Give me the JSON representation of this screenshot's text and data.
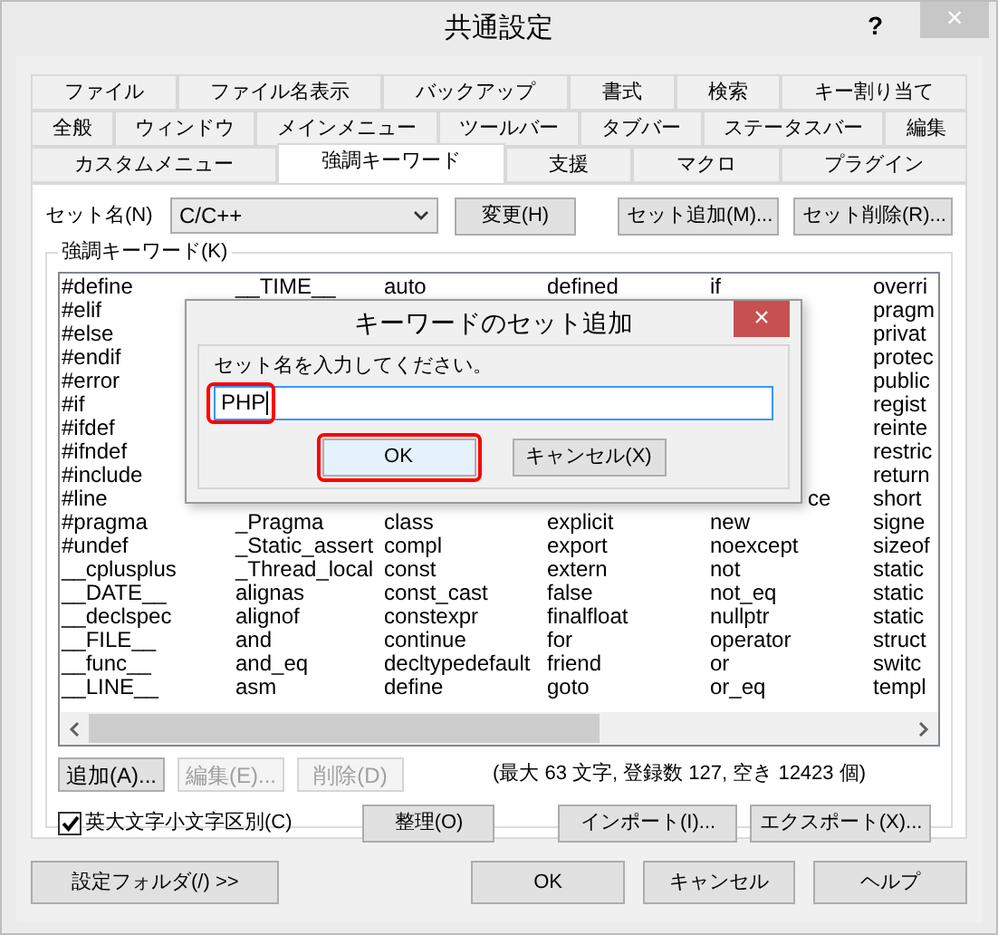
{
  "window": {
    "title": "共通設定",
    "help": "?",
    "close": "×"
  },
  "tab_rows": [
    [
      {
        "label": "ファイル",
        "selected": false
      },
      {
        "label": "ファイル名表示",
        "selected": false
      },
      {
        "label": "バックアップ",
        "selected": false
      },
      {
        "label": "書式",
        "selected": false
      },
      {
        "label": "検索",
        "selected": false
      },
      {
        "label": "キー割り当て",
        "selected": false
      }
    ],
    [
      {
        "label": "全般",
        "selected": false
      },
      {
        "label": "ウィンドウ",
        "selected": false
      },
      {
        "label": "メインメニュー",
        "selected": false
      },
      {
        "label": "ツールバー",
        "selected": false
      },
      {
        "label": "タブバー",
        "selected": false
      },
      {
        "label": "ステータスバー",
        "selected": false
      },
      {
        "label": "編集",
        "selected": false
      }
    ],
    [
      {
        "label": "カスタムメニュー",
        "selected": false
      },
      {
        "label": "強調キーワード",
        "selected": true
      },
      {
        "label": "支援",
        "selected": false
      },
      {
        "label": "マクロ",
        "selected": false
      },
      {
        "label": "プラグイン",
        "selected": false
      }
    ]
  ],
  "set_row": {
    "label": "セット名(N)",
    "value": "C/C++",
    "buttons": [
      "変更(H)",
      "セット追加(M)...",
      "セット削除(R)..."
    ]
  },
  "keywords": {
    "label": "強調キーワード(K)",
    "rows": [
      [
        "#define",
        "__TIME__",
        "auto",
        "defined",
        "if",
        "overri"
      ],
      [
        "#elif",
        null,
        null,
        null,
        null,
        "pragm"
      ],
      [
        "#else",
        null,
        null,
        null,
        null,
        "privat"
      ],
      [
        "#endif",
        null,
        null,
        null,
        null,
        "protec"
      ],
      [
        "#error",
        null,
        null,
        null,
        null,
        "public"
      ],
      [
        "#if",
        null,
        null,
        null,
        null,
        "regist"
      ],
      [
        "#ifdef",
        null,
        null,
        null,
        null,
        "reinte"
      ],
      [
        "#ifndef",
        null,
        null,
        null,
        null,
        "restric"
      ],
      [
        "#include",
        null,
        null,
        null,
        null,
        "return"
      ],
      [
        "#line",
        null,
        null,
        null,
        {
          "text": "ce",
          "kind": "tail"
        },
        "short"
      ],
      [
        "#pragma",
        "_Pragma",
        "class",
        "explicit",
        "new",
        "signe"
      ],
      [
        "#undef",
        "_Static_assert",
        "compl",
        "export",
        "noexcept",
        "sizeof"
      ],
      [
        "__cplusplus",
        "_Thread_local",
        "const",
        "extern",
        "not",
        "static"
      ],
      [
        "__DATE__",
        "alignas",
        "const_cast",
        "false",
        "not_eq",
        "static"
      ],
      [
        "__declspec",
        "alignof",
        "constexpr",
        "finalfloat",
        "nullptr",
        "static"
      ],
      [
        "__FILE__",
        "and",
        "continue",
        "for",
        "operator",
        "struct"
      ],
      [
        "__func__",
        "and_eq",
        "decltypedefault",
        "friend",
        "or",
        "switc"
      ],
      [
        "__LINE__",
        "asm",
        "define",
        "goto",
        "or_eq",
        "templ"
      ]
    ]
  },
  "list_buttons": [
    {
      "label": "追加(A)...",
      "disabled": false
    },
    {
      "label": "編集(E)...",
      "disabled": true
    },
    {
      "label": "削除(D)",
      "disabled": true
    }
  ],
  "stats": "(最大 63 文字, 登録数 127, 空き 12423 個)",
  "case_checkbox": {
    "label": "英大文字小文字区別(C)",
    "checked": true
  },
  "tool_buttons": [
    "整理(O)",
    "インポート(I)...",
    "エクスポート(X)..."
  ],
  "footer_buttons": [
    "設定フォルダ(/) >>",
    "OK",
    "キャンセル",
    "ヘルプ"
  ],
  "dialog": {
    "title": "キーワードのセット追加",
    "close": "×",
    "prompt": "セット名を入力してください。",
    "value": "PHP",
    "buttons": [
      "OK",
      "キャンセル(X)"
    ]
  }
}
